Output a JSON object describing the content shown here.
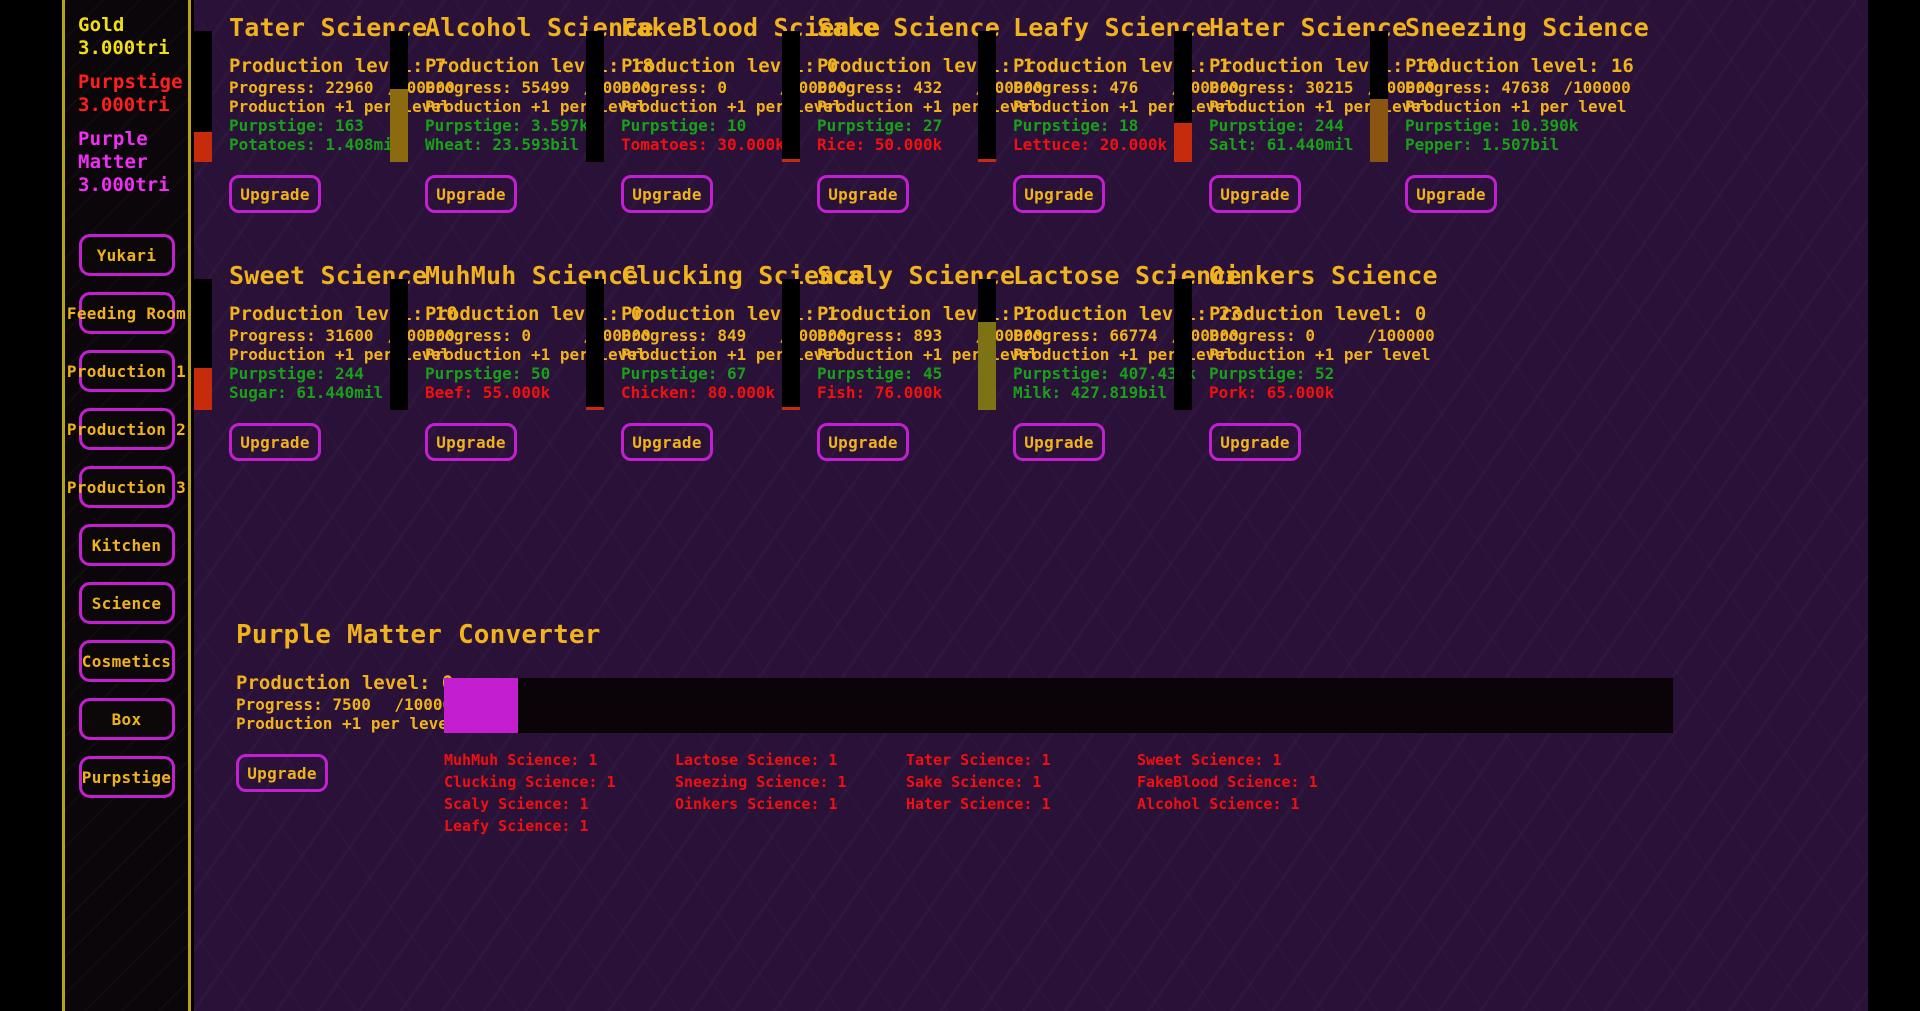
{
  "sidebar": {
    "resources": [
      {
        "name": "Gold",
        "value": "3.000tri",
        "color_class": "res-gold"
      },
      {
        "name": "Purpstige",
        "value": "3.000tri",
        "color_class": "res-purp"
      },
      {
        "name": "Purple Matter",
        "value": "3.000tri",
        "color_class": "res-matter"
      }
    ],
    "nav_items": [
      {
        "label": "Yukari"
      },
      {
        "label": "Feeding Room"
      },
      {
        "label": "Production 1"
      },
      {
        "label": "Production 2"
      },
      {
        "label": "Production 3"
      },
      {
        "label": "Kitchen"
      },
      {
        "label": "Science"
      },
      {
        "label": "Cosmetics"
      },
      {
        "label": "Box"
      },
      {
        "label": "Purpstige"
      }
    ]
  },
  "labels": {
    "production_level_prefix": "Production level: ",
    "progress_prefix": "Progress: ",
    "progress_max": "/100000",
    "per_level": "Production +1 per level",
    "purpstige_prefix": "Purpstige: ",
    "upgrade": "Upgrade"
  },
  "colors": {
    "gold": "#f0b21d",
    "green": "#18a018",
    "red": "#f01010",
    "magenta": "#c21fd0",
    "stage_bg": "#2a1138",
    "yellow_border": "#b8a215"
  },
  "cards": [
    {
      "title": "Tater Science",
      "level": "7",
      "progress": "22960",
      "progress_max": "/100000",
      "purpstige": "163",
      "resource_label": "Potatoes: 1.408mil",
      "resource_ok": true,
      "bar_pct": 23,
      "bar_color": "#c62b0c"
    },
    {
      "title": "Alcohol Science",
      "level": "18",
      "progress": "55499",
      "progress_max": "/100000",
      "purpstige": "3.597k",
      "resource_label": "Wheat: 23.593bil",
      "resource_ok": true,
      "bar_pct": 56,
      "bar_color": "#8c6a10"
    },
    {
      "title": "FakeBlood Science",
      "level": "0",
      "progress": "0",
      "progress_max": "/100000",
      "purpstige": "10",
      "resource_label": "Tomatoes: 30.000k",
      "resource_ok": false,
      "bar_pct": 0,
      "bar_color": "#c62b0c"
    },
    {
      "title": "Sake Science",
      "level": "1",
      "progress": "432",
      "progress_max": "/100000",
      "purpstige": "27",
      "resource_label": "Rice: 50.000k",
      "resource_ok": false,
      "bar_pct": 2,
      "bar_color": "#c62b0c"
    },
    {
      "title": "Leafy Science",
      "level": "1",
      "progress": "476",
      "progress_max": "/100000",
      "purpstige": "18",
      "resource_label": "Lettuce: 20.000k",
      "resource_ok": false,
      "bar_pct": 2,
      "bar_color": "#c62b0c"
    },
    {
      "title": "Hater Science",
      "level": "10",
      "progress": "30215",
      "progress_max": "/100000",
      "purpstige": "244",
      "resource_label": "Salt: 61.440mil",
      "resource_ok": true,
      "bar_pct": 30,
      "bar_color": "#c62b0c"
    },
    {
      "title": "Sneezing Science",
      "level": "16",
      "progress": "47638",
      "progress_max": "/100000",
      "purpstige": "10.390k",
      "resource_label": "Pepper: 1.507bil",
      "resource_ok": true,
      "bar_pct": 48,
      "bar_color": "#8a5510"
    },
    {
      "title": "Sweet Science",
      "level": "10",
      "progress": "31600",
      "progress_max": "/100000",
      "purpstige": "244",
      "resource_label": "Sugar: 61.440mil",
      "resource_ok": true,
      "bar_pct": 32,
      "bar_color": "#c62b0c"
    },
    {
      "title": "MuhMuh Science",
      "level": "0",
      "progress": "0",
      "progress_max": "/100000",
      "purpstige": "50",
      "resource_label": "Beef: 55.000k",
      "resource_ok": false,
      "bar_pct": 0,
      "bar_color": "#c62b0c"
    },
    {
      "title": "Clucking Science",
      "level": "1",
      "progress": "849",
      "progress_max": "/100000",
      "purpstige": "67",
      "resource_label": "Chicken: 80.000k",
      "resource_ok": false,
      "bar_pct": 2,
      "bar_color": "#c62b0c"
    },
    {
      "title": "Scaly Science",
      "level": "1",
      "progress": "893",
      "progress_max": "/100000",
      "purpstige": "45",
      "resource_label": "Fish: 76.000k",
      "resource_ok": false,
      "bar_pct": 2,
      "bar_color": "#c62b0c"
    },
    {
      "title": "Lactose Science",
      "level": "23",
      "progress": "66774",
      "progress_max": "/100000",
      "purpstige": "407.439k",
      "resource_label": "Milk: 427.819bil",
      "resource_ok": true,
      "bar_pct": 67,
      "bar_color": "#7d7315"
    },
    {
      "title": "Oinkers Science",
      "level": "0",
      "progress": "0",
      "progress_max": "/100000",
      "purpstige": "52",
      "resource_label": "Pork: 65.000k",
      "resource_ok": false,
      "bar_pct": 0,
      "bar_color": "#c62b0c"
    }
  ],
  "converter": {
    "title": "Purple Matter Converter",
    "level": "0",
    "progress": "7500",
    "progress_max": "/100000",
    "per_level": "Production +1 per level",
    "upgrade": "Upgrade",
    "meter_pct": 6,
    "requirement_columns": [
      [
        "MuhMuh Science: 1",
        "Clucking Science: 1",
        "Scaly Science: 1",
        "Leafy Science: 1"
      ],
      [
        "Lactose Science: 1",
        "Sneezing Science: 1",
        "Oinkers Science: 1"
      ],
      [
        "Tater Science: 1",
        "Sake Science: 1",
        "Hater Science: 1"
      ],
      [
        "Sweet Science: 1",
        "FakeBlood Science: 1",
        "Alcohol Science: 1"
      ]
    ]
  }
}
